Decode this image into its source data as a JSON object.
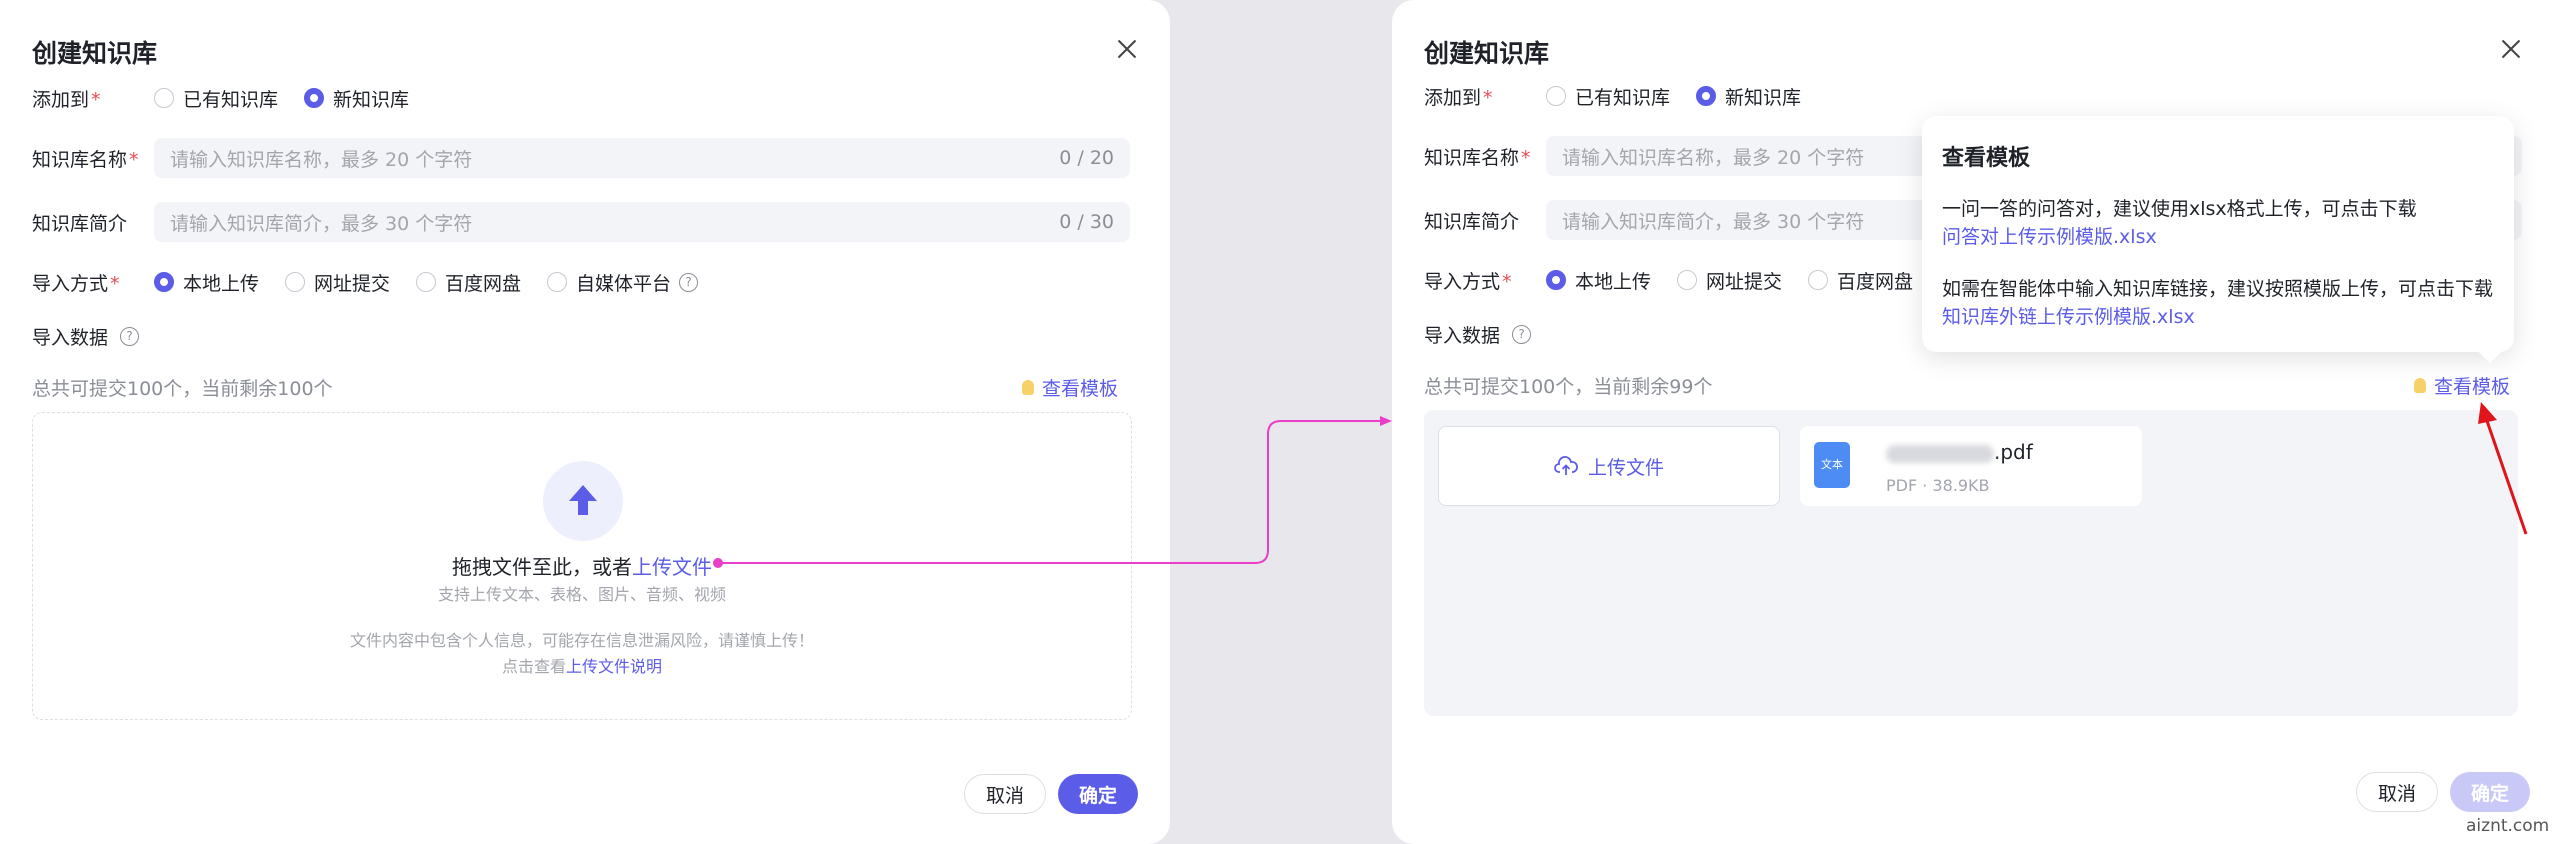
{
  "left_dialog": {
    "title": "创建知识库",
    "add_to": {
      "label": "添加到",
      "options": [
        "已有知识库",
        "新知识库"
      ],
      "selected": "新知识库"
    },
    "name_field": {
      "label": "知识库名称",
      "placeholder": "请输入知识库名称，最多 20 个字符",
      "counter": "0 / 20"
    },
    "intro_field": {
      "label": "知识库简介",
      "placeholder": "请输入知识库简介，最多 30  个字符",
      "counter": "0 / 30"
    },
    "import_method": {
      "label": "导入方式",
      "options": [
        "本地上传",
        "网址提交",
        "百度网盘",
        "自媒体平台"
      ],
      "selected": "本地上传"
    },
    "import_data": {
      "label": "导入数据"
    },
    "quota_text": "总共可提交100个，当前剩余100个",
    "template_link": "查看模板",
    "upload": {
      "main_prefix": "拖拽文件至此，或者",
      "main_link": "上传文件",
      "sub": "支持上传文本、表格、图片、音频、视频",
      "warning": "文件内容中包含个人信息，可能存在信息泄漏风险，请谨慎上传！",
      "note_prefix": "点击查看",
      "note_link": "上传文件说明"
    },
    "cancel": "取消",
    "confirm": "确定"
  },
  "right_dialog": {
    "title": "创建知识库",
    "add_to": {
      "label": "添加到",
      "options": [
        "已有知识库",
        "新知识库"
      ],
      "selected": "新知识库"
    },
    "name_field": {
      "label": "知识库名称",
      "placeholder": "请输入知识库名称，最多 20 个字符"
    },
    "intro_field": {
      "label": "知识库简介",
      "placeholder": "请输入知识库简介，最多 30  个字符"
    },
    "import_method": {
      "label": "导入方式",
      "options": [
        "本地上传",
        "网址提交",
        "百度网盘"
      ],
      "selected": "本地上传"
    },
    "import_data": {
      "label": "导入数据"
    },
    "quota_text": "总共可提交100个，当前剩余99个",
    "template_link": "查看模板",
    "upload_button": "上传文件",
    "file": {
      "icon_label": "文本",
      "name_suffix": ".pdf",
      "meta": "PDF · 38.9KB"
    },
    "cancel": "取消",
    "confirm": "确定",
    "popover": {
      "title": "查看模板",
      "text1": "一问一答的问答对，建议使用xlsx格式上传，可点击下载",
      "link1": "问答对上传示例模版.xlsx",
      "text2": "如需在智能体中输入知识库链接，建议按照模版上传，可点击下载",
      "link2": "知识库外链上传示例模版.xlsx"
    }
  },
  "watermark": "aiznt.com",
  "colors": {
    "accent": "#5b5ce8",
    "required": "#e34d59",
    "annotation": "#e83ec8",
    "arrow": "#e0151b"
  }
}
